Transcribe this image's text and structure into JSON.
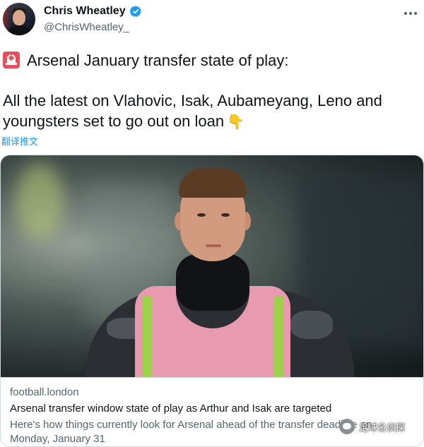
{
  "author": {
    "name": "Chris Wheatley",
    "handle": "@ChrisWheatley_"
  },
  "tweet": {
    "line1": "Arsenal January transfer state of play:",
    "line2": "All the latest on Vlahovic, Isak, Aubameyang, Leno and youngsters set to go out on loan",
    "translate_label": "翻译推文"
  },
  "card": {
    "domain": "football.london",
    "title": "Arsenal transfer window state of play as Arthur and Isak are targeted",
    "description": "Here's how things currently look for Arsenal ahead of the transfer deadline on Monday, January 31"
  },
  "watermark": {
    "text": "足球名侦探"
  },
  "icons": {
    "verified": "verified-badge-icon",
    "more": "more-options-icon",
    "siren": "rotating-light-icon",
    "pointing": "backhand-index-pointing-down-icon"
  },
  "colors": {
    "accent": "#1d9bf0",
    "text": "#0f1419",
    "secondary": "#536471",
    "border": "#cfd9de"
  }
}
